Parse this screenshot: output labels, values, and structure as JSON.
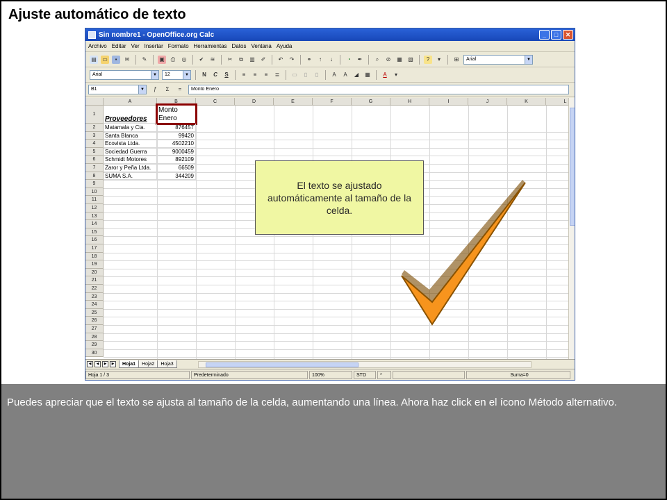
{
  "slide": {
    "title": "Ajuste automático de texto",
    "callout_text": "El texto se ajustado automáticamente al tamaño de la celda.",
    "instruction_text": "Puedes apreciar que el texto se ajusta al tamaño de la celda, aumentando una línea. Ahora haz click en el ícono Método alternativo."
  },
  "window": {
    "title": "Sin nombre1 - OpenOffice.org Calc",
    "menu": [
      "Archivo",
      "Editar",
      "Ver",
      "Insertar",
      "Formato",
      "Herramientas",
      "Datos",
      "Ventana",
      "Ayuda"
    ],
    "font_name_top": "Arial",
    "font_name": "Arial",
    "font_size": "12",
    "name_box": "B1",
    "formula_content": "Monto Enero"
  },
  "grid": {
    "columns": [
      "A",
      "B",
      "C",
      "D",
      "E",
      "F",
      "G",
      "H",
      "I",
      "J",
      "K",
      "L"
    ],
    "row_numbers": [
      "1",
      "2",
      "3",
      "4",
      "5",
      "6",
      "7",
      "8",
      "9",
      "10",
      "11",
      "12",
      "13",
      "14",
      "15",
      "16",
      "17",
      "18",
      "19",
      "20",
      "21",
      "22",
      "23",
      "24",
      "25",
      "26",
      "27",
      "28",
      "29",
      "30"
    ],
    "header_a1": "Proveedores",
    "header_b1": "Monto Enero",
    "rows": [
      {
        "name": "Matamala y Cia.",
        "value": "876457"
      },
      {
        "name": "Santa Blanca",
        "value": "99420"
      },
      {
        "name": "Ecovista Ltda.",
        "value": "4502210"
      },
      {
        "name": "Sociedad Guerra",
        "value": "9000459"
      },
      {
        "name": "Schmidt Motores",
        "value": "892109"
      },
      {
        "name": "Zaror y Peña Ltda.",
        "value": "66509"
      },
      {
        "name": "SUMA S.A.",
        "value": "344209"
      }
    ]
  },
  "sheets": [
    "Hoja1",
    "Hoja2",
    "Hoja3"
  ],
  "status": {
    "sheet": "Hoja 1 / 3",
    "style": "Predeterminado",
    "zoom": "100%",
    "mode": "STD",
    "modified": "*",
    "sum": "Suma=0"
  },
  "colors": {
    "callout_bg": "#f0f7a3",
    "selection_border": "#8b0000",
    "checkmark_fill": "#f7941d",
    "panel_bg": "#808080"
  }
}
